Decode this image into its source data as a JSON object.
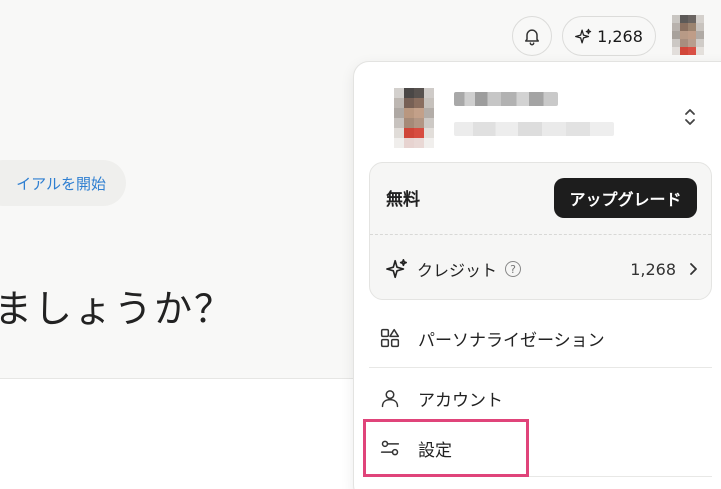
{
  "background": {
    "trial_button_label": "イアルを開始",
    "hero_text": "ましょうか？"
  },
  "topbar": {
    "bell_icon": "bell-icon",
    "credits_value": "1,268",
    "credits_icon": "sparkle-icon"
  },
  "dropdown": {
    "plan": {
      "name": "無料",
      "upgrade_label": "アップグレード"
    },
    "credits": {
      "label": "クレジット",
      "help_icon_text": "?",
      "value": "1,268"
    },
    "menu": [
      {
        "label": "パーソナライゼーション",
        "icon": "grid-shapes-icon"
      },
      {
        "label": "アカウント",
        "icon": "user-icon"
      },
      {
        "label": "設定",
        "icon": "sliders-icon"
      }
    ]
  },
  "colors": {
    "accent_link": "#2f7fd1",
    "upgrade_bg": "#1d1d1d",
    "highlight": "#e0447a"
  }
}
